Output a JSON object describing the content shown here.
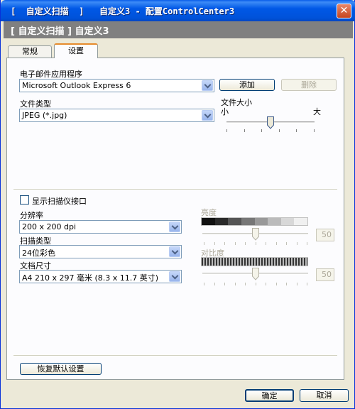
{
  "window": {
    "title": "[  自定义扫描  ]   自定义3 - 配置ControlCenter3",
    "close_glyph": "✕"
  },
  "banner": {
    "text": "[ 自定义扫描 ] 自定义3"
  },
  "tabs": [
    {
      "label": "常规",
      "active": false
    },
    {
      "label": "设置",
      "active": true
    }
  ],
  "email": {
    "label": "电子邮件应用程序",
    "value": "Microsoft Outlook Express 6",
    "add_label": "添加",
    "delete_label": "删除"
  },
  "file_type": {
    "label": "文件类型",
    "value": "JPEG (*.jpg)"
  },
  "file_size": {
    "label": "文件大小",
    "min_label": "小",
    "max_label": "大",
    "level": 0.5
  },
  "scanner_ui": {
    "label": "显示扫描仪接口",
    "checked": false
  },
  "resolution": {
    "label": "分辨率",
    "value": "200 x 200 dpi"
  },
  "scan_type": {
    "label": "扫描类型",
    "value": "24位彩色"
  },
  "doc_size": {
    "label": "文档尺寸",
    "value": "A4 210 x 297 毫米 (8.3 x 11.7 英寸)"
  },
  "brightness": {
    "label": "亮度",
    "value": "50",
    "level": 0.5
  },
  "contrast": {
    "label": "对比度",
    "value": "50",
    "level": 0.5
  },
  "restore_label": "恢复默认设置",
  "ok_label": "确定",
  "cancel_label": "取消",
  "colors": {
    "title_bar": "#0058e6",
    "banner": "#808080",
    "active_tab_accent": "#e68b2c"
  }
}
